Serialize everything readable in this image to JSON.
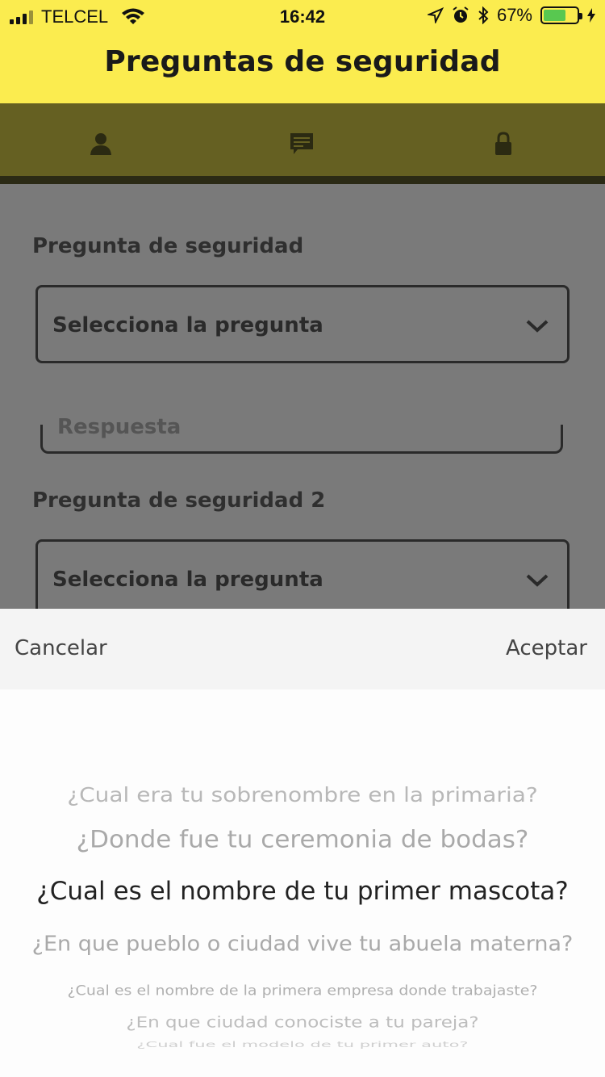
{
  "status_bar": {
    "carrier": "TELCEL",
    "time": "16:42",
    "battery_percent": "67%",
    "battery_level": 0.67,
    "icons": [
      "signal-icon",
      "wifi-icon",
      "location-icon",
      "alarm-icon",
      "bluetooth-icon",
      "battery-icon",
      "charging-icon"
    ]
  },
  "header": {
    "title": "Preguntas de seguridad"
  },
  "tabs": [
    {
      "icon": "user-icon"
    },
    {
      "icon": "message-icon"
    },
    {
      "icon": "lock-icon"
    }
  ],
  "form": {
    "question1_label": "Pregunta de seguridad",
    "question1_value": "Selecciona la pregunta",
    "answer1_placeholder": "Respuesta",
    "question2_label": "Pregunta de seguridad 2",
    "question2_value": "Selecciona la pregunta"
  },
  "picker": {
    "cancel_label": "Cancelar",
    "accept_label": "Aceptar",
    "options": [
      "¿Cual era tu sobrenombre en la primaria?",
      "¿Donde fue tu ceremonia de bodas?",
      "¿Cual es el nombre de tu primer mascota?",
      "¿En que pueblo o ciudad vive tu abuela materna?",
      "¿Cual es el nombre de la primera empresa donde trabajaste?",
      "¿En que ciudad conociste a tu pareja?",
      "¿Cual fue el modelo de tu primer auto?"
    ],
    "selected_index": 2
  },
  "colors": {
    "header_yellow": "#fbec4f",
    "tab_bar": "#656022",
    "overlay_gray": "#7a7a7a",
    "picker_toolbar": "#f4f4f4",
    "battery_green": "#58c850"
  }
}
